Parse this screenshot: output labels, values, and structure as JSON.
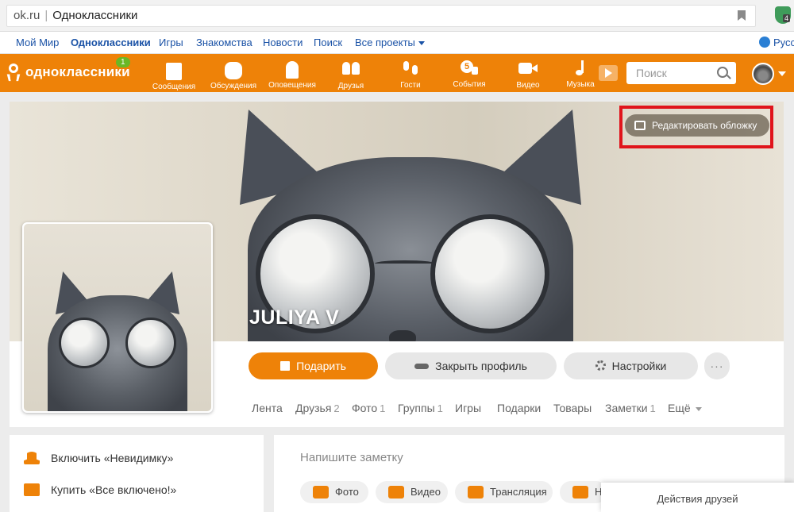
{
  "browser": {
    "url": "ok.ru",
    "page_title": "Одноклассники",
    "extension_badge": "4"
  },
  "topnav": {
    "items": [
      "Мой Мир",
      "Одноклассники",
      "Игры",
      "Знакомства",
      "Новости",
      "Поиск",
      "Все проекты"
    ],
    "language": "Русс"
  },
  "header": {
    "logo_text": "одноклассники",
    "logo_badge": "1",
    "nav": [
      {
        "label": "Сообщения",
        "icon": "envelope-icon"
      },
      {
        "label": "Обсуждения",
        "icon": "chat-bubble-icon"
      },
      {
        "label": "Оповещения",
        "icon": "bell-icon"
      },
      {
        "label": "Друзья",
        "icon": "friends-icon"
      },
      {
        "label": "Гости",
        "icon": "footprints-icon"
      },
      {
        "label": "События",
        "icon": "events-icon"
      },
      {
        "label": "Видео",
        "icon": "video-camera-icon"
      },
      {
        "label": "Музыка",
        "icon": "music-note-icon"
      }
    ],
    "search_placeholder": "Поиск"
  },
  "profile": {
    "name": "JULIYA V",
    "edit_cover_label": "Редактировать обложку",
    "buttons": {
      "gift": "Подарить",
      "close_profile": "Закрыть профиль",
      "settings": "Настройки",
      "more": "···"
    },
    "tabs": [
      {
        "label": "Лента",
        "count": ""
      },
      {
        "label": "Друзья",
        "count": "2"
      },
      {
        "label": "Фото",
        "count": "1"
      },
      {
        "label": "Группы",
        "count": "1"
      },
      {
        "label": "Игры",
        "count": ""
      },
      {
        "label": "Подарки",
        "count": ""
      },
      {
        "label": "Товары",
        "count": ""
      },
      {
        "label": "Заметки",
        "count": "1"
      },
      {
        "label": "Ещё",
        "count": ""
      }
    ]
  },
  "sidebar": {
    "items": [
      "Включить «Невидимку»",
      "Купить «Все включено!»"
    ]
  },
  "composer": {
    "placeholder": "Напишите заметку",
    "chips": [
      "Фото",
      "Видео",
      "Трансляция",
      "Н"
    ]
  },
  "friends_actions": "Действия друзей",
  "colors": {
    "brand_orange": "#ee8208",
    "link_blue": "#1a52a6",
    "highlight_red": "#e0141b"
  }
}
